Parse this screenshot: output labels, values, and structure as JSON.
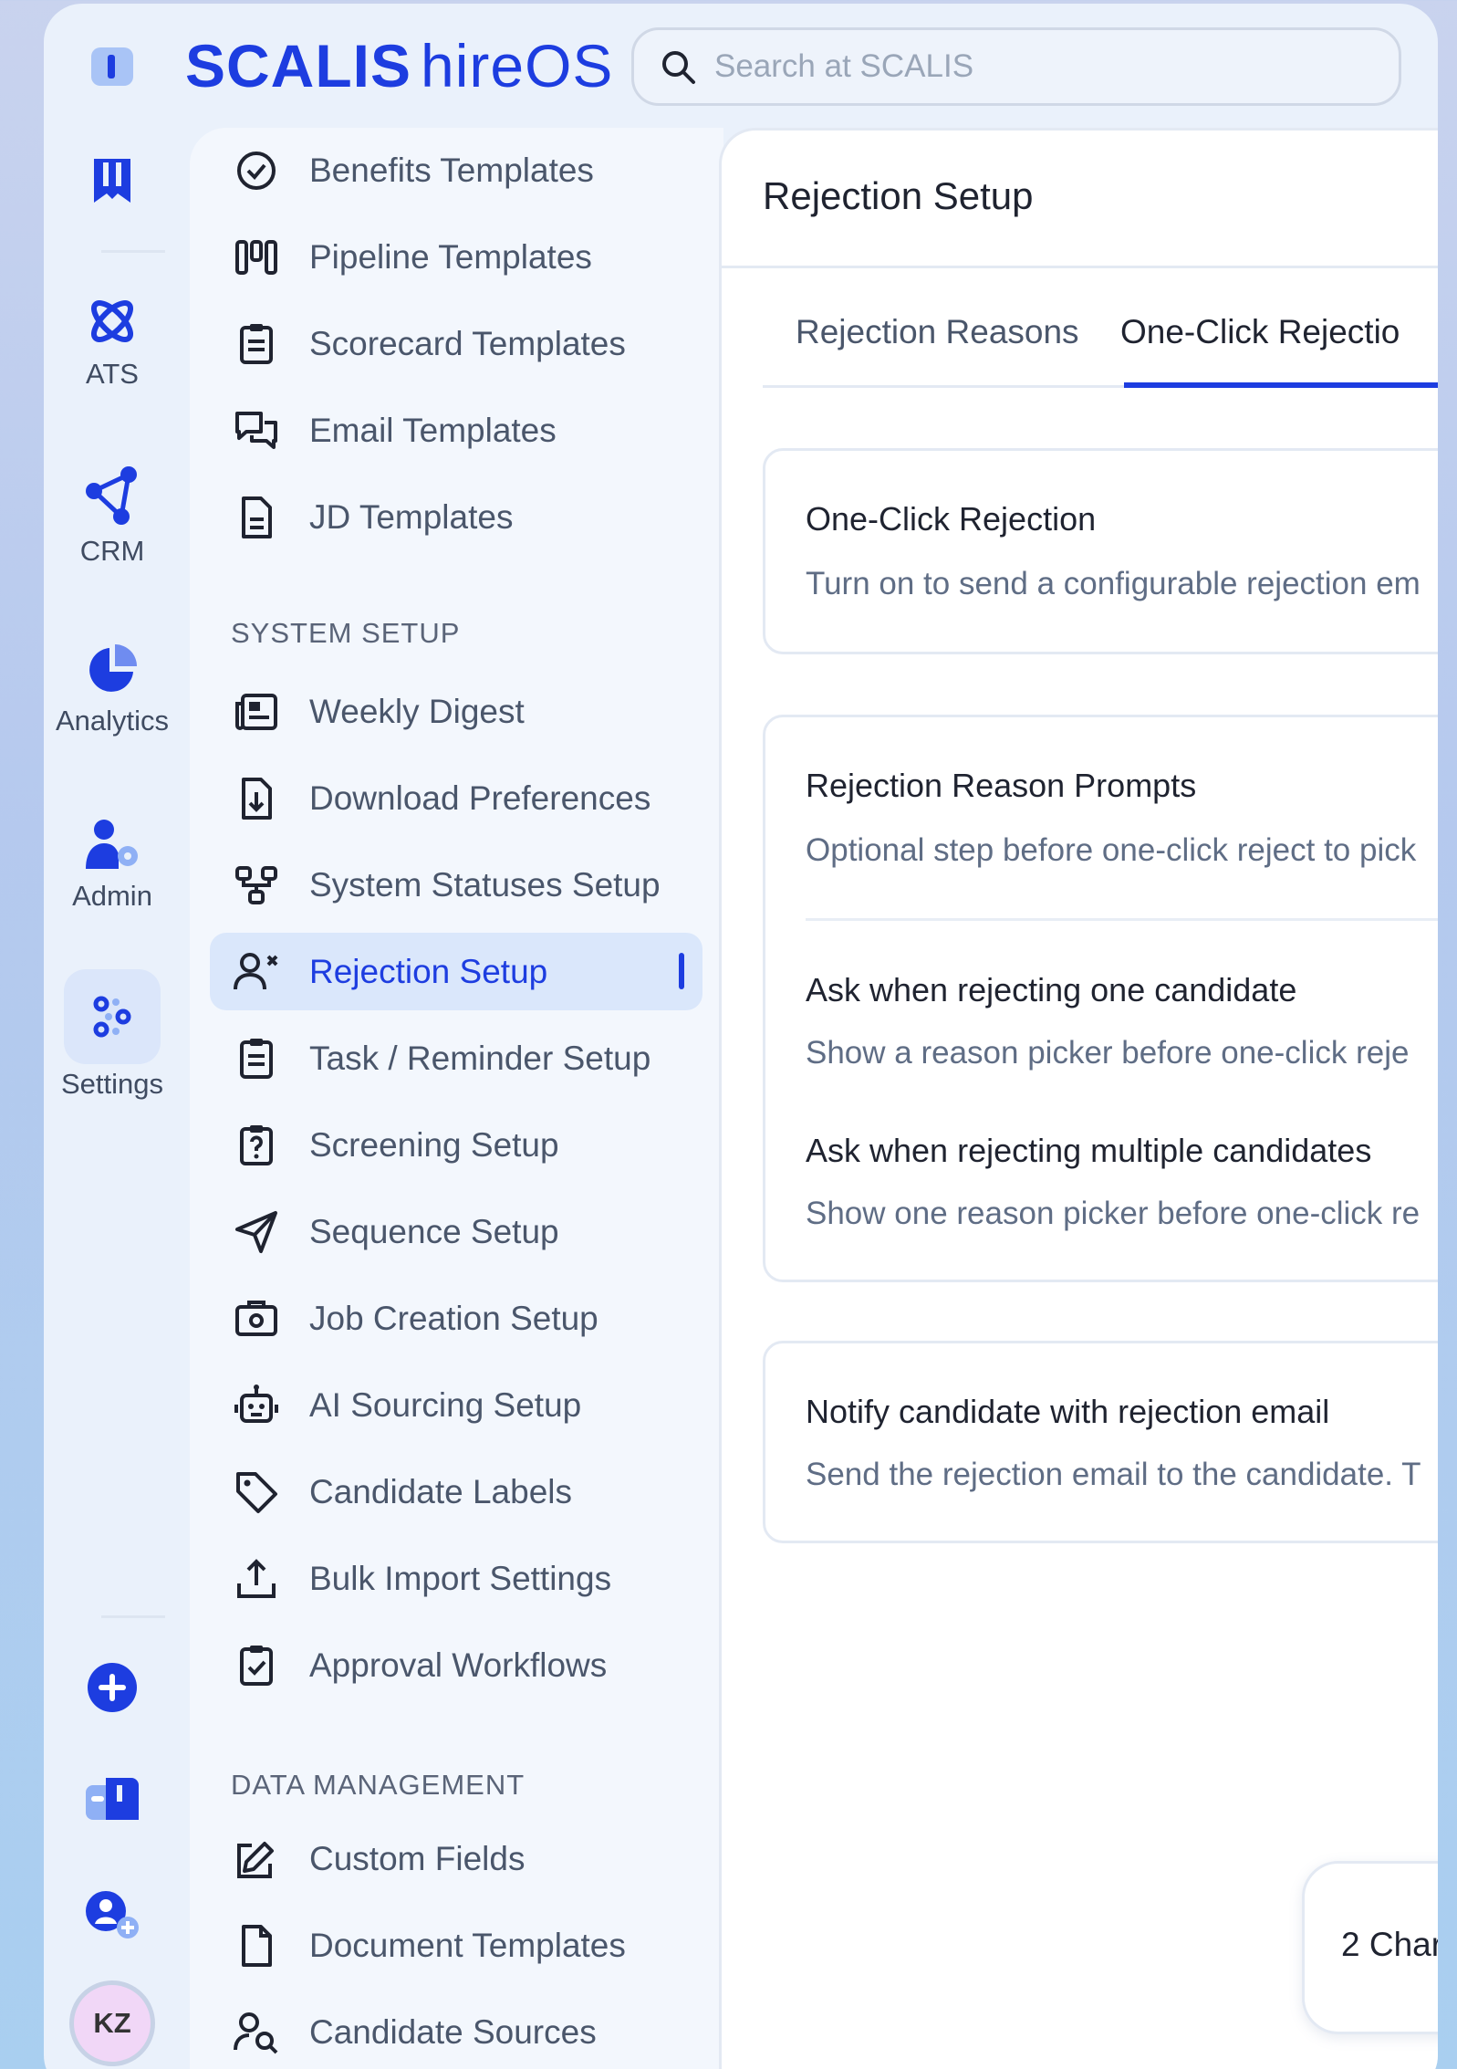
{
  "brand": {
    "name": "SCALIS",
    "product": "hireOS",
    "color": "#1d3de0"
  },
  "search": {
    "placeholder": "Search at SCALIS"
  },
  "rail": {
    "ats": "ATS",
    "crm": "CRM",
    "analytics": "Analytics",
    "admin": "Admin",
    "settings": "Settings",
    "avatar": "KZ"
  },
  "menu": {
    "templates": [
      "Benefits Templates",
      "Pipeline Templates",
      "Scorecard Templates",
      "Email Templates",
      "JD Templates"
    ],
    "system_header": "SYSTEM SETUP",
    "system": [
      "Weekly Digest",
      "Download Preferences",
      "System Statuses Setup",
      "Rejection Setup",
      "Task / Reminder Setup",
      "Screening Setup",
      "Sequence Setup",
      "Job Creation Setup",
      "AI Sourcing Setup",
      "Candidate Labels",
      "Bulk Import Settings",
      "Approval Workflows"
    ],
    "data_header": "DATA MANAGEMENT",
    "data": [
      "Custom Fields",
      "Document Templates",
      "Candidate Sources"
    ]
  },
  "main": {
    "title": "Rejection Setup",
    "tabs": [
      "Rejection Reasons",
      "One-Click Rejectio"
    ],
    "cards": {
      "oneclick": {
        "title": "One-Click Rejection",
        "desc": "Turn on to send a configurable rejection em"
      },
      "prompts": {
        "title": "Rejection Reason Prompts",
        "desc": "Optional step before one-click reject to pick"
      },
      "one": {
        "title": "Ask when rejecting one candidate",
        "desc": "Show a reason picker before one-click reje"
      },
      "multi": {
        "title": "Ask when rejecting multiple candidates",
        "desc": "Show one reason picker before one-click re"
      },
      "notify": {
        "title": "Notify candidate with rejection email",
        "desc": "Send the rejection email to the candidate. T"
      }
    },
    "chat": "2 Char"
  }
}
